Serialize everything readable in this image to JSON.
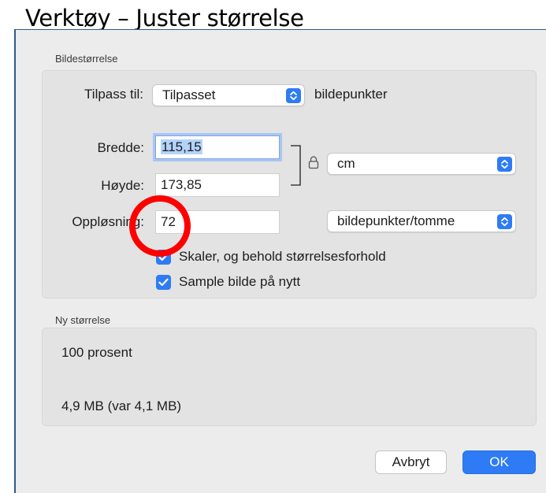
{
  "page_title": "Verktøy – Juster størrelse",
  "image_size": {
    "section_label": "Bildestørrelse",
    "fit_label": "Tilpass til:",
    "fit_value": "Tilpasset",
    "fit_unit": "bildepunkter",
    "width_label": "Bredde:",
    "width_value": "115,15",
    "height_label": "Høyde:",
    "height_value": "173,85",
    "size_unit": "cm",
    "resolution_label": "Oppløsning:",
    "resolution_value": "72",
    "resolution_unit": "bildepunkter/tomme",
    "scale_checkbox": {
      "label": "Skaler, og behold størrelsesforhold",
      "checked": true
    },
    "resample_checkbox": {
      "label": "Sample bilde på nytt",
      "checked": true
    }
  },
  "new_size": {
    "section_label": "Ny størrelse",
    "percent": "100 prosent",
    "file_size": "4,9 MB (var 4,1 MB)"
  },
  "buttons": {
    "cancel": "Avbryt",
    "ok": "OK"
  },
  "colors": {
    "accent": "#2f7bf5",
    "highlight_ring": "#ff0000",
    "window_border": "#2e5a8c"
  },
  "icons": [
    "chevron-updown-icon",
    "lock-icon",
    "checkmark-icon"
  ]
}
